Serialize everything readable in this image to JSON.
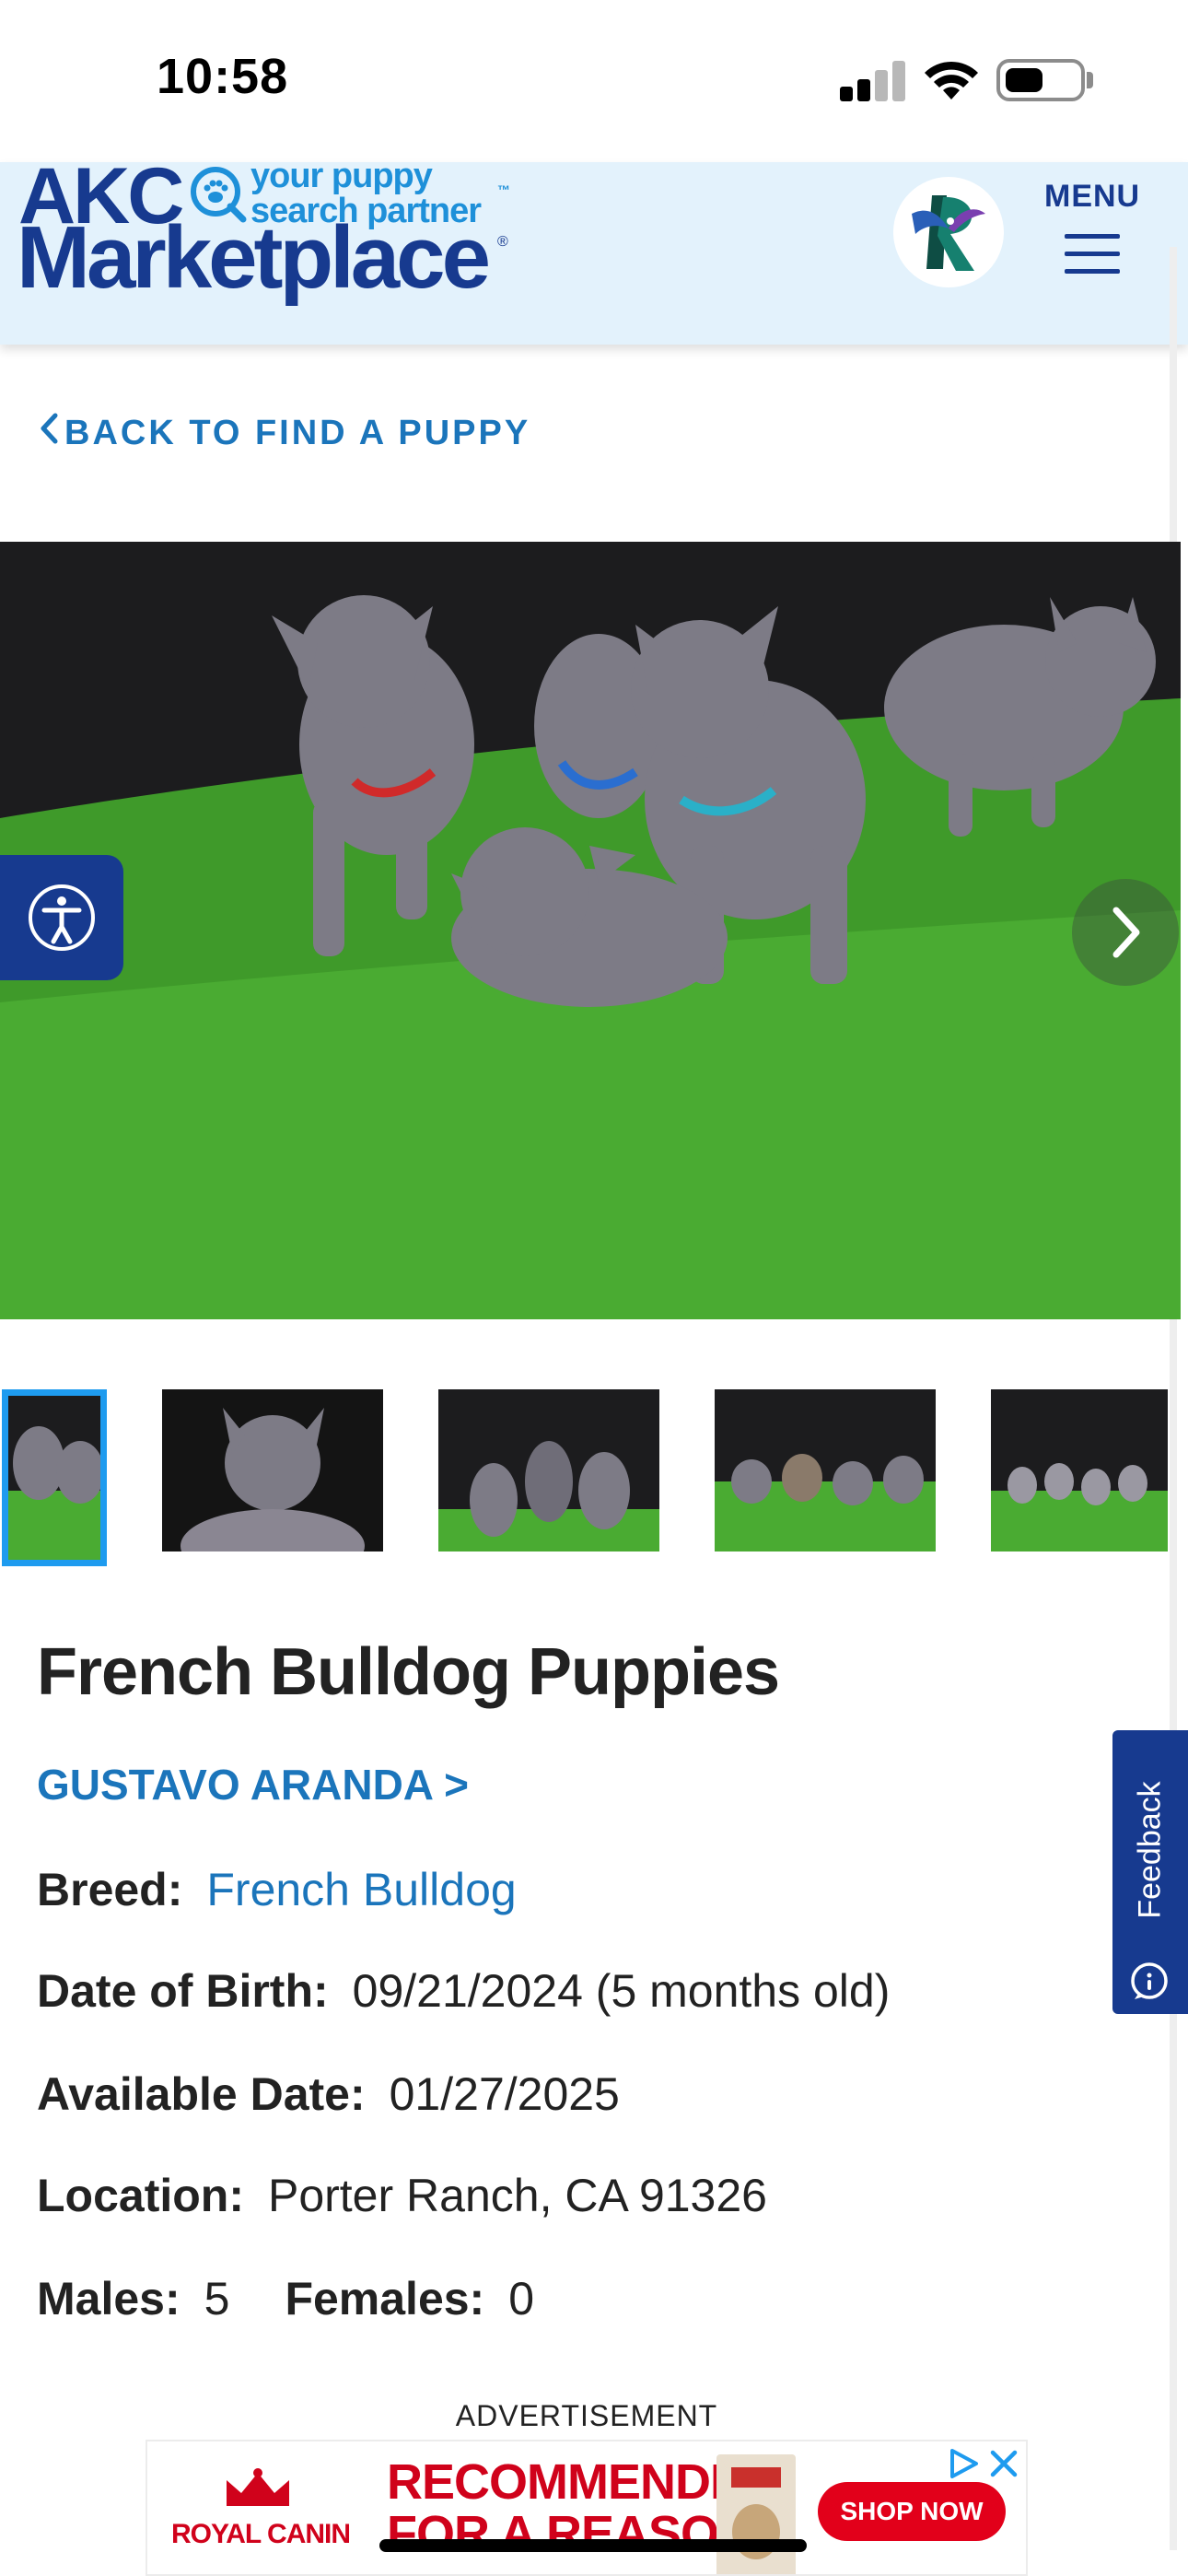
{
  "status_bar": {
    "time": "10:58"
  },
  "header": {
    "logo_akc": "AKC",
    "logo_tagline_line1": "your puppy",
    "logo_tagline_line2": "search partner",
    "logo_marketplace": "Marketplace",
    "menu_label": "MENU"
  },
  "navigation": {
    "back_label": "BACK TO FIND A PUPPY"
  },
  "listing": {
    "title": "French Bulldog Puppies",
    "breeder": "GUSTAVO ARANDA >",
    "breed_label": "Breed:",
    "breed_value": "French Bulldog",
    "dob_label": "Date of Birth:",
    "dob_value": "09/21/2024 (5 months old)",
    "available_label": "Available Date:",
    "available_value": "01/27/2025",
    "location_label": "Location:",
    "location_value": "Porter Ranch, CA 91326",
    "males_label": "Males:",
    "males_value": "5",
    "females_label": "Females:",
    "females_value": "0"
  },
  "gallery": {
    "thumbnail_count": 5,
    "active_index": 0
  },
  "feedback": {
    "label": "Feedback"
  },
  "ad": {
    "label": "ADVERTISEMENT",
    "brand": "ROYAL CANIN",
    "headline_line1": "RECOMMENDED",
    "headline_line2": "FOR A REASON",
    "cta": "SHOP NOW"
  },
  "colors": {
    "akc_navy": "#173a8f",
    "link_blue": "#1b75bb",
    "header_bg": "#e3f2fc",
    "thumb_active": "#1e9bef",
    "ad_red": "#d0021b"
  },
  "icons": [
    "signal-icon",
    "wifi-icon",
    "battery-icon",
    "paw-icon",
    "menu-icon",
    "chevron-left-icon",
    "accessibility-icon",
    "chevron-right-icon",
    "feedback-icon",
    "ad-choices-icon",
    "close-icon"
  ]
}
